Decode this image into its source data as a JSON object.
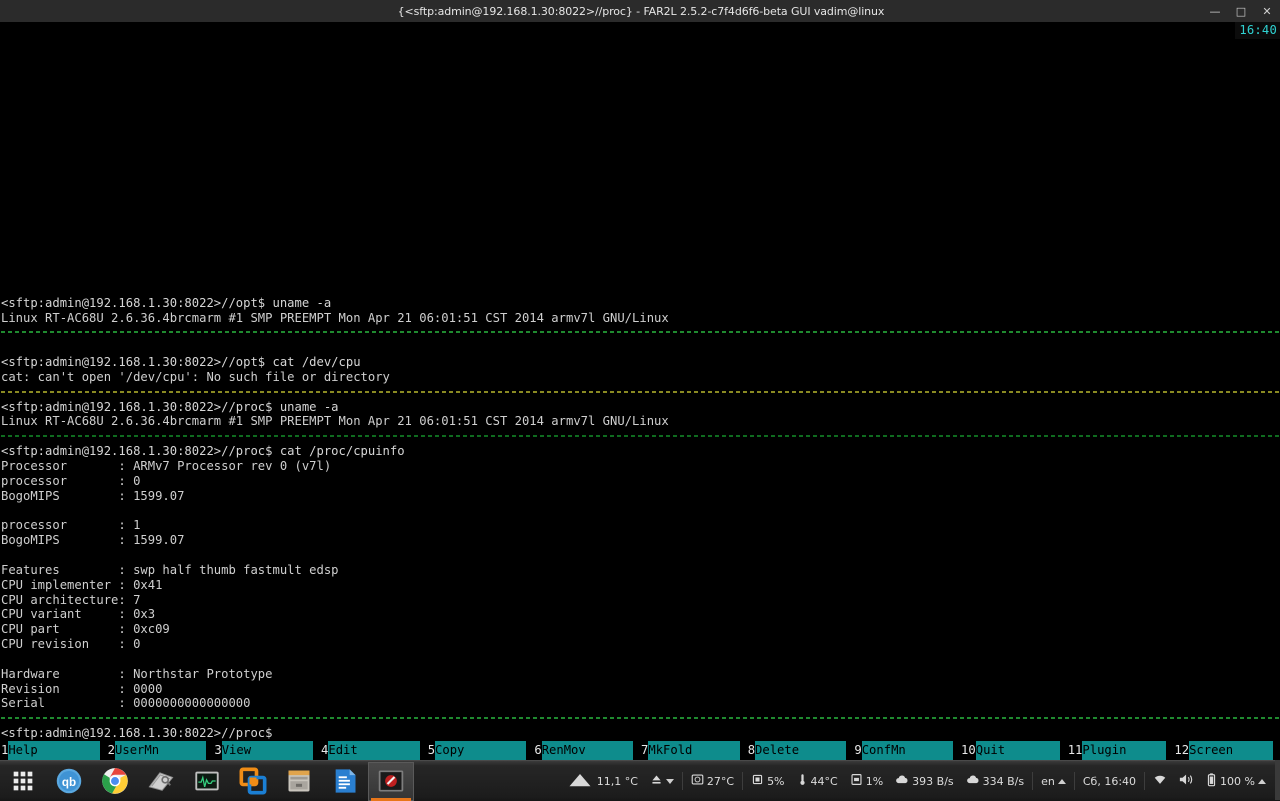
{
  "window": {
    "title": "{<sftp:admin@192.168.1.30:8022>//proc} - FAR2L 2.5.2-c7f4d6f6-beta GUI vadim@linux",
    "minimize_label": "—",
    "maximize_label": "□",
    "close_label": "✕"
  },
  "terminal": {
    "clock": "16:40",
    "lines": [
      {
        "kind": "text",
        "style": "prompt",
        "text": "<sftp:admin@192.168.1.30:8022>//opt$ uname -a"
      },
      {
        "kind": "text",
        "style": "out",
        "text": "Linux RT-AC68U 2.6.36.4brcmarm #1 SMP PREEMPT Mon Apr 21 06:01:51 CST 2014 armv7l GNU/Linux"
      },
      {
        "kind": "sep",
        "style": "sep-green",
        "text": ""
      },
      {
        "kind": "text",
        "style": "out",
        "text": ""
      },
      {
        "kind": "text",
        "style": "prompt",
        "text": "<sftp:admin@192.168.1.30:8022>//opt$ cat /dev/cpu"
      },
      {
        "kind": "text",
        "style": "out",
        "text": "cat: can't open '/dev/cpu': No such file or directory"
      },
      {
        "kind": "sep",
        "style": "sep-olive",
        "text": ""
      },
      {
        "kind": "text",
        "style": "prompt",
        "text": "<sftp:admin@192.168.1.30:8022>//proc$ uname -a"
      },
      {
        "kind": "text",
        "style": "out",
        "text": "Linux RT-AC68U 2.6.36.4brcmarm #1 SMP PREEMPT Mon Apr 21 06:01:51 CST 2014 armv7l GNU/Linux"
      },
      {
        "kind": "sep",
        "style": "sep-dkgreen",
        "text": ""
      },
      {
        "kind": "text",
        "style": "prompt",
        "text": "<sftp:admin@192.168.1.30:8022>//proc$ cat /proc/cpuinfo"
      },
      {
        "kind": "text",
        "style": "out",
        "text": "Processor       : ARMv7 Processor rev 0 (v7l)"
      },
      {
        "kind": "text",
        "style": "out",
        "text": "processor       : 0"
      },
      {
        "kind": "text",
        "style": "out",
        "text": "BogoMIPS        : 1599.07"
      },
      {
        "kind": "text",
        "style": "out",
        "text": ""
      },
      {
        "kind": "text",
        "style": "out",
        "text": "processor       : 1"
      },
      {
        "kind": "text",
        "style": "out",
        "text": "BogoMIPS        : 1599.07"
      },
      {
        "kind": "text",
        "style": "out",
        "text": ""
      },
      {
        "kind": "text",
        "style": "out",
        "text": "Features        : swp half thumb fastmult edsp"
      },
      {
        "kind": "text",
        "style": "out",
        "text": "CPU implementer : 0x41"
      },
      {
        "kind": "text",
        "style": "out",
        "text": "CPU architecture: 7"
      },
      {
        "kind": "text",
        "style": "out",
        "text": "CPU variant     : 0x3"
      },
      {
        "kind": "text",
        "style": "out",
        "text": "CPU part        : 0xc09"
      },
      {
        "kind": "text",
        "style": "out",
        "text": "CPU revision    : 0"
      },
      {
        "kind": "text",
        "style": "out",
        "text": ""
      },
      {
        "kind": "text",
        "style": "out",
        "text": "Hardware        : Northstar Prototype"
      },
      {
        "kind": "text",
        "style": "out",
        "text": "Revision        : 0000"
      },
      {
        "kind": "text",
        "style": "out",
        "text": "Serial          : 0000000000000000"
      },
      {
        "kind": "sep",
        "style": "sep-green",
        "text": ""
      },
      {
        "kind": "text",
        "style": "prompt",
        "text": "<sftp:admin@192.168.1.30:8022>//proc$"
      }
    ]
  },
  "fkeys": [
    {
      "num": "1",
      "label": "Help"
    },
    {
      "num": "2",
      "label": "UserMn"
    },
    {
      "num": "3",
      "label": "View"
    },
    {
      "num": "4",
      "label": "Edit"
    },
    {
      "num": "5",
      "label": "Copy"
    },
    {
      "num": "6",
      "label": "RenMov"
    },
    {
      "num": "7",
      "label": "MkFold"
    },
    {
      "num": "8",
      "label": "Delete"
    },
    {
      "num": "9",
      "label": "ConfMn"
    },
    {
      "num": "10",
      "label": "Quit"
    },
    {
      "num": "11",
      "label": "Plugin"
    },
    {
      "num": "12",
      "label": "Screen"
    }
  ],
  "taskbar": {
    "launchers": [
      {
        "name": "app-grid",
        "icon": "grid"
      },
      {
        "name": "qbittorrent",
        "icon": "qb"
      },
      {
        "name": "google-chrome",
        "icon": "chrome"
      },
      {
        "name": "dictionary",
        "icon": "book"
      },
      {
        "name": "system-monitor",
        "icon": "monitor"
      },
      {
        "name": "virtualbox",
        "icon": "vbox"
      },
      {
        "name": "file-manager",
        "icon": "drawer"
      },
      {
        "name": "libreoffice-writer",
        "icon": "writer"
      },
      {
        "name": "far2l",
        "icon": "far2l",
        "active": true
      }
    ],
    "tray": {
      "weather_temp": "11,1 °C",
      "eject_label": "",
      "disk_temp": "27°C",
      "cpu_usage": "5%",
      "cpu_temp": "44°C",
      "mem_usage": "1%",
      "net_up": "393 B/s",
      "net_down": "334 B/s",
      "keyboard_layout": "en",
      "clock": "Сб, 16:40",
      "battery": "100 %"
    }
  }
}
